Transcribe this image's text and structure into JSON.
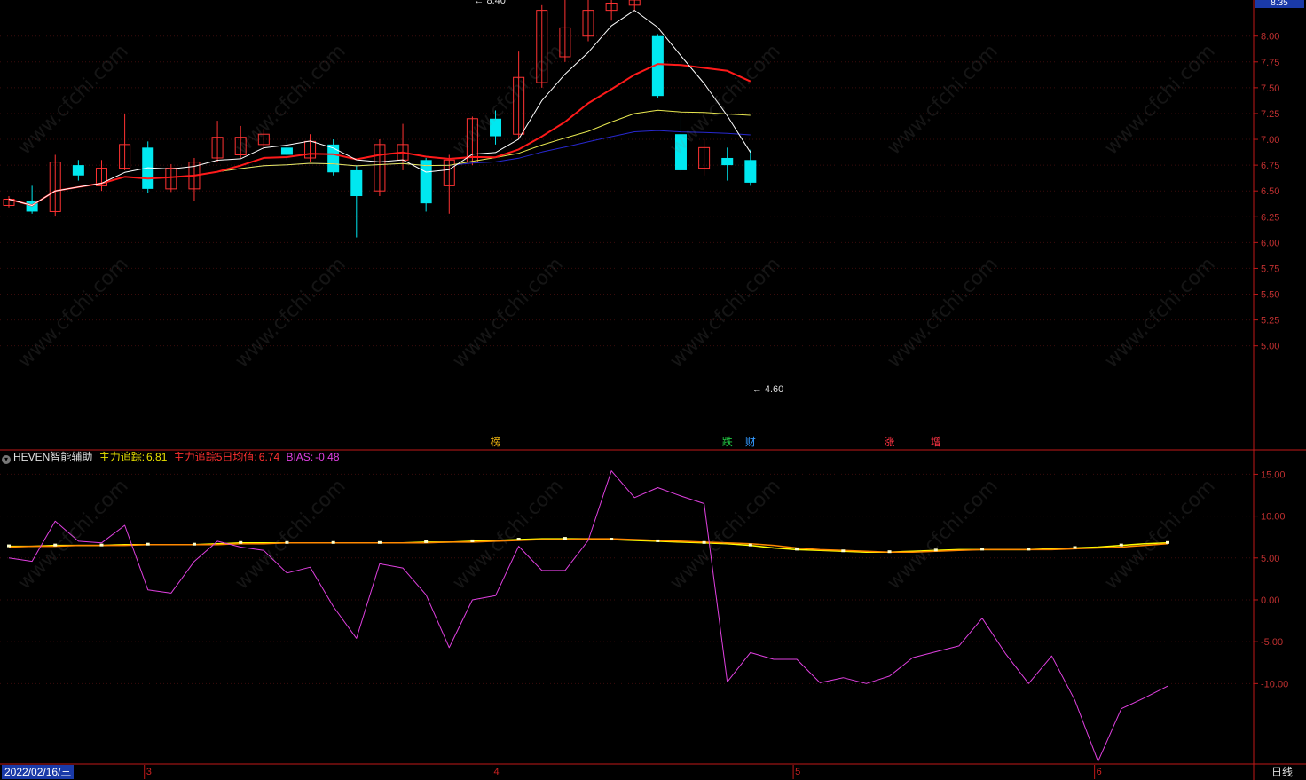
{
  "header": {
    "price_current": "8.35"
  },
  "legend": {
    "indicator_name": "HEVEN智能辅助",
    "track_label": "主力追踪:",
    "track_value": "6.81",
    "track_ma_label": "主力追踪5日均值:",
    "track_ma_value": "6.74",
    "bias_label": "BIAS:",
    "bias_value": "-0.48"
  },
  "footer": {
    "date": "2022/02/16/三",
    "period": "日线",
    "months": [
      {
        "label": "3",
        "i": 6
      },
      {
        "label": "4",
        "i": 21
      },
      {
        "label": "5",
        "i": 34
      },
      {
        "label": "6",
        "i": 47
      }
    ]
  },
  "flags": [
    {
      "text": "榜",
      "i": 21,
      "color": "#e8b010"
    },
    {
      "text": "跌",
      "i": 31,
      "color": "#22cc44"
    },
    {
      "text": "财",
      "i": 32,
      "color": "#3399ff"
    },
    {
      "text": "涨",
      "i": 38,
      "color": "#ff3344"
    },
    {
      "text": "增",
      "i": 40,
      "color": "#ff3344"
    }
  ],
  "watermark": "www.cfchi.com",
  "colors": {
    "up": "#ff3232",
    "down": "#00e8f0",
    "ma5": "#ffffff",
    "ma10": "#ff1a1a",
    "ma20": "#e8e850",
    "ma60": "#2828d0",
    "track": "#ffff00",
    "track_ma": "#ff8800",
    "bias": "#e040e0",
    "axis": "#c01818",
    "label": "#c03030"
  },
  "chart_data": [
    {
      "type": "candlestick",
      "title": "",
      "ylim": [
        4.0,
        8.35
      ],
      "yticks": [
        5.0,
        5.25,
        5.5,
        5.75,
        6.0,
        6.25,
        6.5,
        6.75,
        7.0,
        7.25,
        7.5,
        7.75,
        8.0
      ],
      "annotations": [
        {
          "text": "8.40",
          "i": 20,
          "value": 8.4
        },
        {
          "text": "4.60",
          "i": 32,
          "value": 4.6
        }
      ],
      "ohlc": [
        [
          6.36,
          6.42,
          6.45,
          6.34
        ],
        [
          6.4,
          6.3,
          6.55,
          6.28
        ],
        [
          6.3,
          6.78,
          6.85,
          6.26
        ],
        [
          6.75,
          6.65,
          6.8,
          6.6
        ],
        [
          6.55,
          6.72,
          6.8,
          6.5
        ],
        [
          6.72,
          6.95,
          7.25,
          6.7
        ],
        [
          6.92,
          6.52,
          6.98,
          6.48
        ],
        [
          6.52,
          6.72,
          6.76,
          6.49
        ],
        [
          6.52,
          6.78,
          6.82,
          6.4
        ],
        [
          6.82,
          7.02,
          7.18,
          6.78
        ],
        [
          6.85,
          7.02,
          7.13,
          6.82
        ],
        [
          6.95,
          7.05,
          7.1,
          6.9
        ],
        [
          6.92,
          6.85,
          7.0,
          6.8
        ],
        [
          6.82,
          6.98,
          7.05,
          6.78
        ],
        [
          6.95,
          6.68,
          7.0,
          6.65
        ],
        [
          6.7,
          6.45,
          6.75,
          6.05
        ],
        [
          6.5,
          6.95,
          7.0,
          6.45
        ],
        [
          6.8,
          6.95,
          7.15,
          6.7
        ],
        [
          6.8,
          6.38,
          6.82,
          6.3
        ],
        [
          6.55,
          6.8,
          6.85,
          6.28
        ],
        [
          6.78,
          7.2,
          7.22,
          6.75
        ],
        [
          7.2,
          7.03,
          7.28,
          6.95
        ],
        [
          7.05,
          7.6,
          7.85,
          7.0
        ],
        [
          7.55,
          8.25,
          8.3,
          7.5
        ],
        [
          7.8,
          8.08,
          8.35,
          7.75
        ],
        [
          8.0,
          8.25,
          8.38,
          7.95
        ],
        [
          8.25,
          8.32,
          8.35,
          8.15
        ],
        [
          8.3,
          8.35,
          8.4,
          8.25
        ],
        [
          8.0,
          7.42,
          8.02,
          7.4
        ],
        [
          7.05,
          6.7,
          7.22,
          6.68
        ],
        [
          6.72,
          6.92,
          7.0,
          6.65
        ],
        [
          6.82,
          6.75,
          6.92,
          6.6
        ],
        [
          6.8,
          6.58,
          6.9,
          6.55
        ]
      ]
    },
    {
      "type": "line",
      "title": "",
      "ylim": [
        -19.5,
        17.8
      ],
      "yticks": [
        15.0,
        10.0,
        5.0,
        0.0,
        -5.0,
        -10.0
      ],
      "series": [
        {
          "name": "主力追踪",
          "values": [
            6.4,
            6.4,
            6.5,
            6.5,
            6.5,
            6.6,
            6.6,
            6.6,
            6.6,
            6.7,
            6.8,
            6.8,
            6.8,
            6.8,
            6.8,
            6.8,
            6.8,
            6.8,
            6.9,
            6.9,
            7.0,
            7.1,
            7.2,
            7.3,
            7.3,
            7.3,
            7.2,
            7.1,
            7.0,
            6.9,
            6.8,
            6.7,
            6.5,
            6.2,
            6.0,
            5.9,
            5.8,
            5.7,
            5.7,
            5.8,
            5.9,
            6.0,
            6.0,
            6.0,
            6.0,
            6.1,
            6.2,
            6.3,
            6.5,
            6.7,
            6.8
          ]
        },
        {
          "name": "主力追踪5日均值",
          "values": [
            6.3,
            6.4,
            6.4,
            6.5,
            6.5,
            6.5,
            6.6,
            6.6,
            6.6,
            6.6,
            6.7,
            6.7,
            6.8,
            6.8,
            6.8,
            6.8,
            6.8,
            6.8,
            6.8,
            6.9,
            6.9,
            7.0,
            7.1,
            7.2,
            7.2,
            7.3,
            7.3,
            7.2,
            7.1,
            7.0,
            6.9,
            6.8,
            6.7,
            6.5,
            6.2,
            6.0,
            5.9,
            5.8,
            5.7,
            5.7,
            5.8,
            5.9,
            6.0,
            6.0,
            6.0,
            6.0,
            6.1,
            6.2,
            6.3,
            6.5,
            6.7
          ]
        },
        {
          "name": "BIAS",
          "values": [
            5.0,
            4.6,
            9.4,
            7.0,
            6.8,
            8.9,
            1.2,
            0.8,
            4.6,
            7.0,
            6.3,
            5.9,
            3.2,
            3.9,
            -0.8,
            -4.6,
            4.3,
            3.8,
            0.6,
            -5.7,
            0.0,
            0.5,
            6.4,
            3.5,
            3.5,
            7.1,
            15.4,
            12.2,
            13.4,
            12.4,
            11.5,
            -9.8,
            -6.3,
            -7.1,
            -7.1,
            -9.9,
            -9.3,
            -10.0,
            -9.1,
            -6.9,
            -6.2,
            -5.5,
            -2.2,
            -6.4,
            -10.0,
            -6.7,
            -12.0,
            -19.3,
            -13.0,
            -11.7,
            -10.3
          ]
        }
      ]
    }
  ]
}
